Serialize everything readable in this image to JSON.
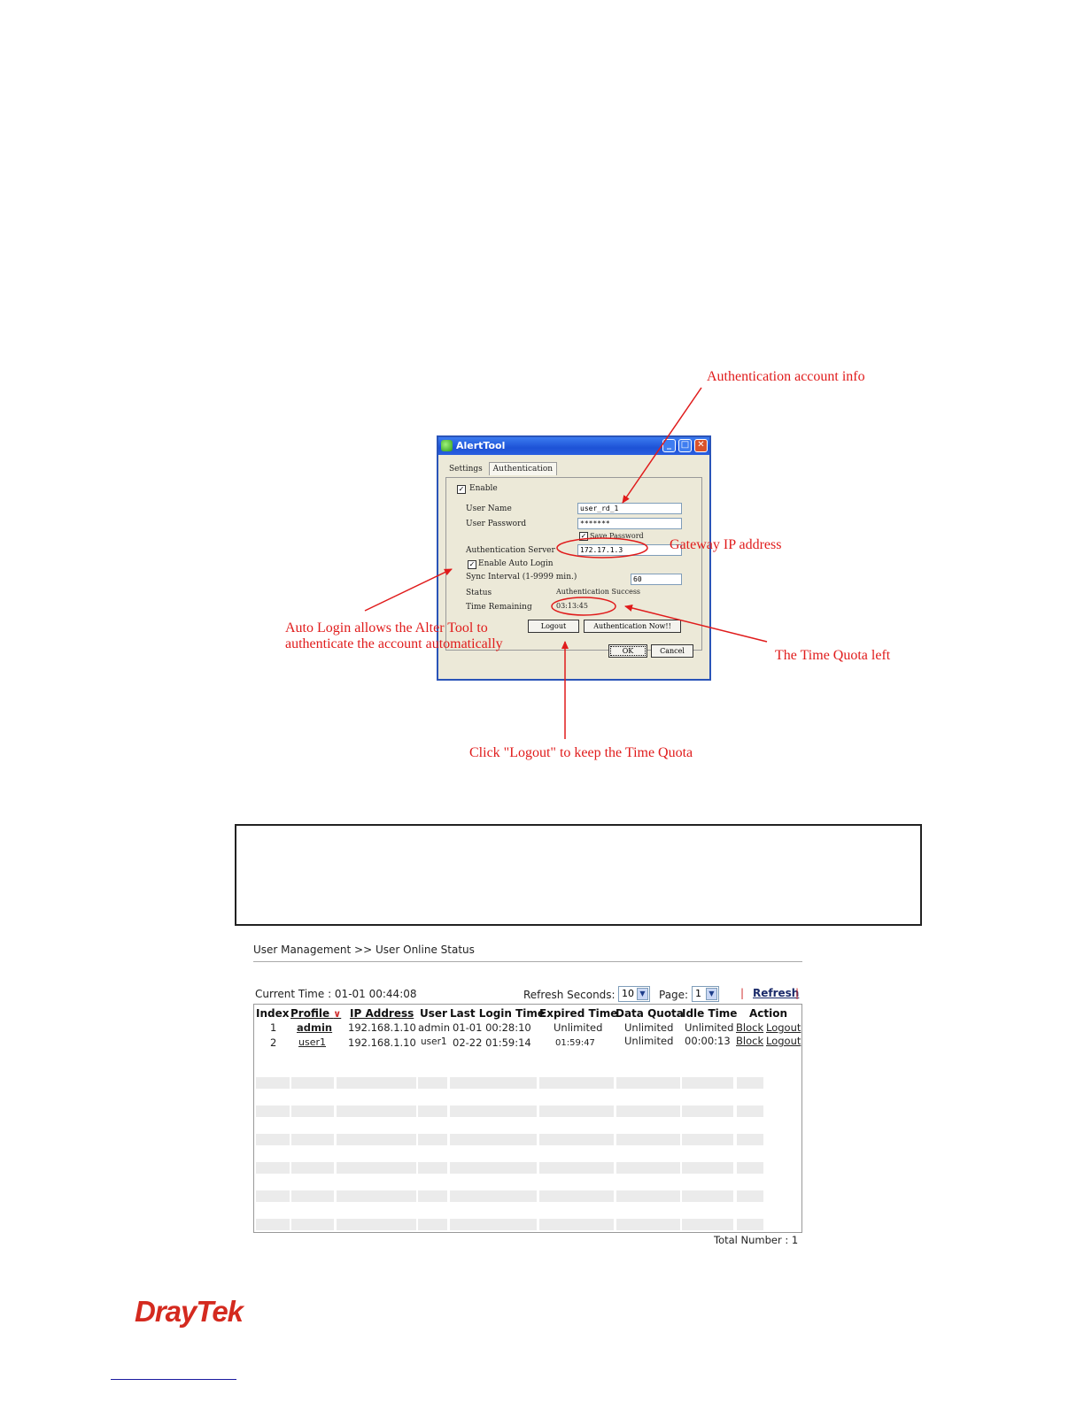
{
  "dialog": {
    "title": "AlertTool",
    "tabs": [
      "Settings",
      "Authentication"
    ],
    "enable_label": "Enable",
    "user_name_label": "User Name",
    "user_name_value": "user_rd_1",
    "user_password_label": "User Password",
    "user_password_value": "*******",
    "save_password_label": "Save Password",
    "auth_server_label": "Authentication Server",
    "auth_server_value": "172.17.1.3",
    "auto_login_label": "Enable Auto Login",
    "sync_interval_label": "Sync Interval (1-9999 min.)",
    "sync_interval_value": "60",
    "status_label": "Status",
    "status_value": "Authentication Success",
    "time_remaining_label": "Time Remaining",
    "time_remaining_value": "03:13:45",
    "logout_button": "Logout",
    "auth_now_button": "Authentication Now!!",
    "ok_button": "OK",
    "cancel_button": "Cancel"
  },
  "annotations": {
    "account_info": "Authentication account info",
    "gateway_ip": "Gateway IP address",
    "auto_login_line1": "Auto Login allows the Alter Tool to",
    "auto_login_line2": "authenticate the account automatically",
    "time_quota_left": "The Time Quota left",
    "click_logout": "Click \"Logout\" to keep the Time Quota",
    "color": "#e01b1b"
  },
  "web": {
    "breadcrumb": "User Management >> User Online Status",
    "current_time": "Current Time : 01-01 00:44:08",
    "refresh_seconds_label": "Refresh Seconds:",
    "refresh_seconds_value": "10",
    "page_label": "Page:",
    "page_value": "1",
    "refresh_link": "Refresh",
    "separator": "|",
    "columns": [
      "Index",
      "Profile",
      "IP Address",
      "User",
      "Last Login Time",
      "Expired Time",
      "Data Quota",
      "Idle Time",
      "Action"
    ],
    "rows": [
      {
        "index": "1",
        "profile": "admin",
        "ip": "192.168.1.10",
        "user": "admin",
        "last_login": "01-01 00:28:10",
        "expired": "Unlimited",
        "data_quota": "Unlimited",
        "idle": "Unlimited",
        "block": "Block",
        "logout": "Logout"
      },
      {
        "index": "2",
        "profile": "user1",
        "ip": "192.168.1.10",
        "user": "user1",
        "last_login": "02-22 01:59:14",
        "expired": "01:59:47",
        "data_quota": "Unlimited",
        "idle": "00:00:13",
        "block": "Block",
        "logout": "Logout"
      }
    ],
    "total_number": "Total Number : 1"
  },
  "logo": {
    "part1": "Dray",
    "part2": "Tek",
    "color": "#d42a1f"
  }
}
